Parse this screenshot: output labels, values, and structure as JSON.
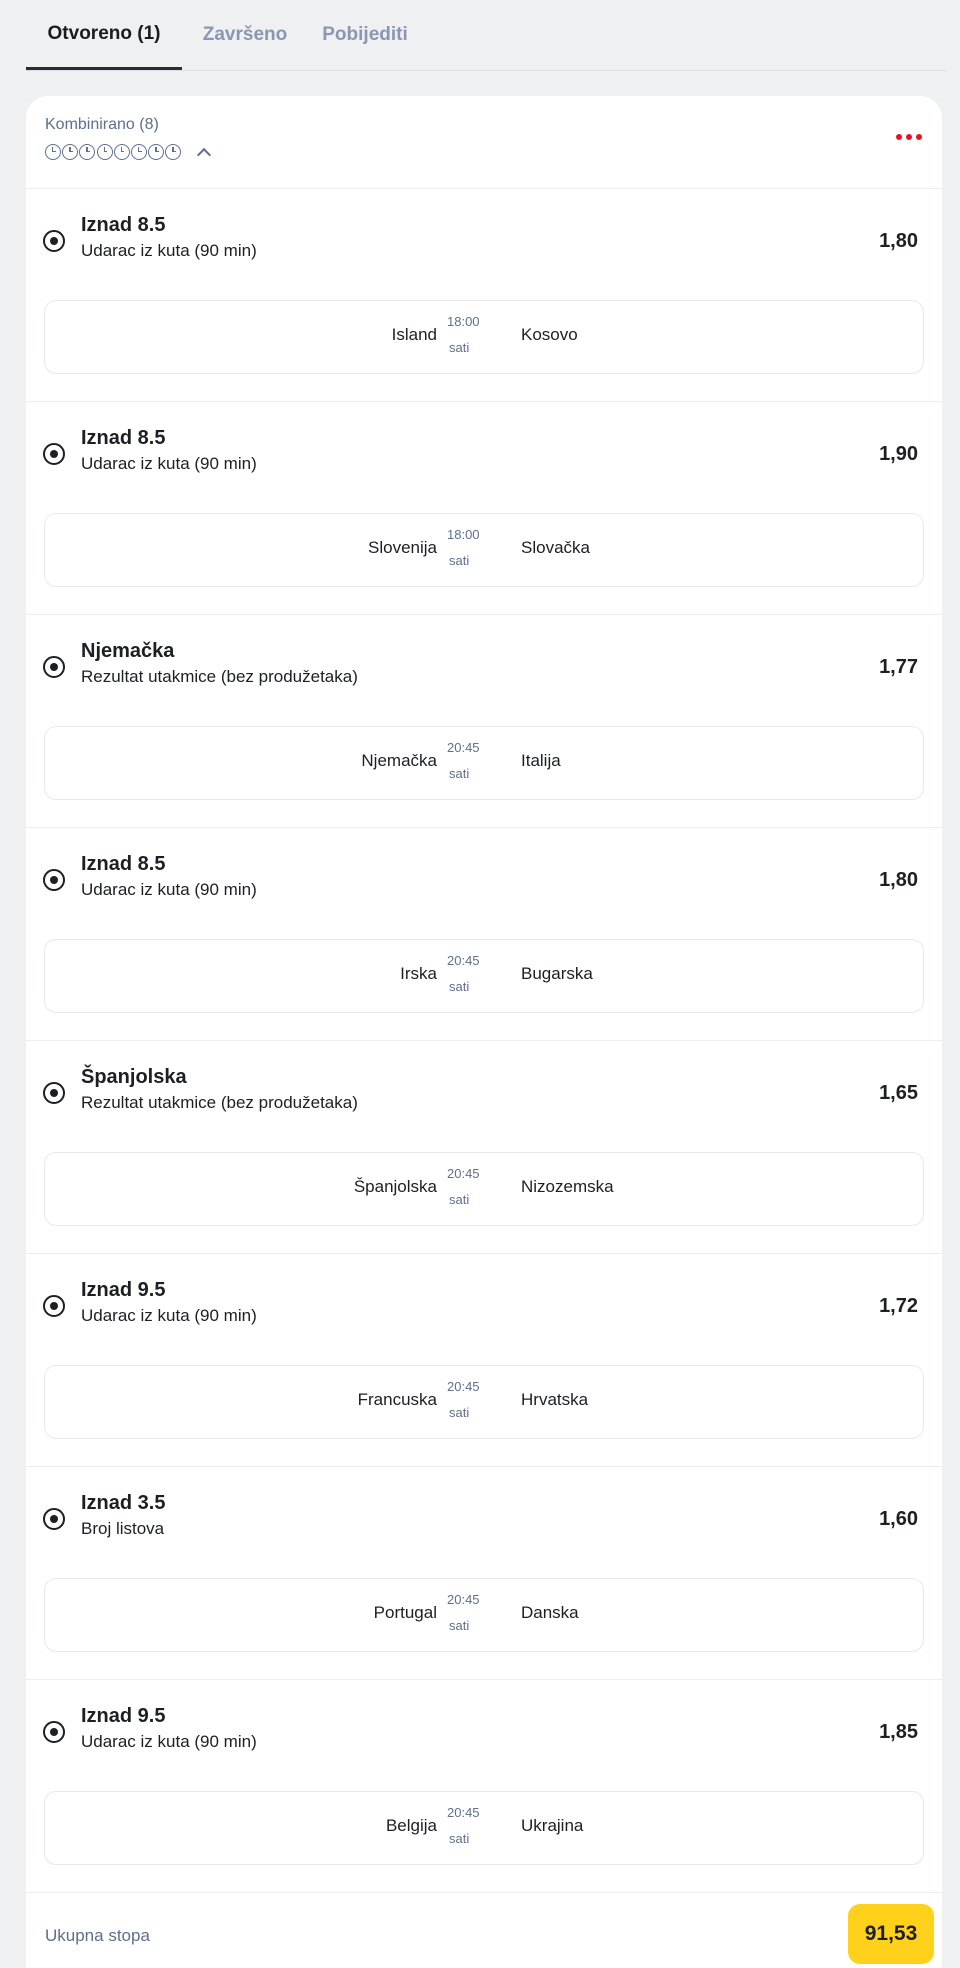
{
  "tabs": [
    {
      "label": "Otvoreno (1)"
    },
    {
      "label": "Završeno"
    },
    {
      "label": "Pobijediti"
    }
  ],
  "ticket": {
    "type_label": "Kombinirano (8)",
    "accent_color": "#e3161f",
    "selections": [
      {
        "pick": "Iznad 8.5",
        "market": "Udarac iz kuta (90 min)",
        "odds": "1,80",
        "home": "Island",
        "time": "18:00",
        "time_unit": "sati",
        "away": "Kosovo"
      },
      {
        "pick": "Iznad 8.5",
        "market": "Udarac iz kuta (90 min)",
        "odds": "1,90",
        "home": "Slovenija",
        "time": "18:00",
        "time_unit": "sati",
        "away": "Slovačka"
      },
      {
        "pick": "Njemačka",
        "market": "Rezultat utakmice (bez produžetaka)",
        "odds": "1,77",
        "home": "Njemačka",
        "time": "20:45",
        "time_unit": "sati",
        "away": "Italija"
      },
      {
        "pick": "Iznad 8.5",
        "market": "Udarac iz kuta (90 min)",
        "odds": "1,80",
        "home": "Irska",
        "time": "20:45",
        "time_unit": "sati",
        "away": "Bugarska"
      },
      {
        "pick": "Španjolska",
        "market": "Rezultat utakmice (bez produžetaka)",
        "odds": "1,65",
        "home": "Španjolska",
        "time": "20:45",
        "time_unit": "sati",
        "away": "Nizozemska"
      },
      {
        "pick": "Iznad 9.5",
        "market": "Udarac iz kuta (90 min)",
        "odds": "1,72",
        "home": "Francuska",
        "time": "20:45",
        "time_unit": "sati",
        "away": "Hrvatska"
      },
      {
        "pick": "Iznad 3.5",
        "market": "Broj listova",
        "odds": "1,60",
        "home": "Portugal",
        "time": "20:45",
        "time_unit": "sati",
        "away": "Danska"
      },
      {
        "pick": "Iznad 9.5",
        "market": "Udarac iz kuta (90 min)",
        "odds": "1,85",
        "home": "Belgija",
        "time": "20:45",
        "time_unit": "sati",
        "away": "Ukrajina"
      }
    ],
    "total_label": "Ukupna stopa",
    "total_value": "91,53",
    "total_badge_color": "#ffd11a"
  }
}
